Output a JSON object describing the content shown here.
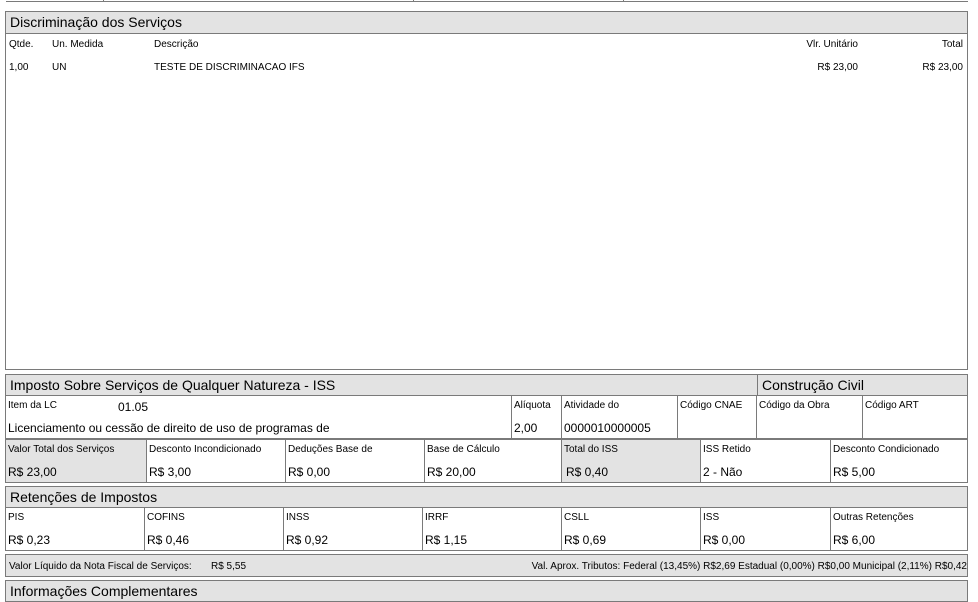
{
  "discriminacao": {
    "title": "Discriminação dos Serviços",
    "headers": {
      "qtde": "Qtde.",
      "un": "Un. Medida",
      "descricao": "Descrição",
      "vlr_unit": "Vlr. Unitário",
      "total": "Total"
    },
    "row": {
      "qtde": "1,00",
      "un": "UN",
      "descricao": "TESTE DE DISCRIMINACAO IFS",
      "vlr_unit": "R$ 23,00",
      "total": "R$ 23,00"
    }
  },
  "iss": {
    "title": "Imposto Sobre Serviços de Qualquer Natureza - ISS",
    "construcao_title": "Construção Civil",
    "item_lc_label": "Item da LC",
    "item_lc_value": "01.05",
    "item_desc": "Licenciamento ou cessão de direito de uso de programas de",
    "aliquota_label": "Alíquota",
    "aliquota_value": "2,00",
    "atividade_label": "Atividade do",
    "atividade_value": "0000010000005",
    "cnae_label": "Código CNAE",
    "obra_label": "Código da Obra",
    "art_label": "Código ART"
  },
  "valores": [
    {
      "label": "Valor Total dos Serviços",
      "value": "R$ 23,00"
    },
    {
      "label": "Desconto Incondicionado",
      "value": "R$ 3,00"
    },
    {
      "label": "Deduções Base de",
      "value": "R$ 0,00"
    },
    {
      "label": "Base de Cálculo",
      "value": "R$ 20,00"
    },
    {
      "label": "Total do ISS",
      "value": "R$ 0,40"
    },
    {
      "label": "ISS Retido",
      "value": "2 - Não"
    },
    {
      "label": "Desconto Condicionado",
      "value": "R$ 5,00"
    }
  ],
  "retencoes": {
    "title": "Retenções de Impostos",
    "items": [
      {
        "label": "PIS",
        "value": "R$ 0,23"
      },
      {
        "label": "COFINS",
        "value": "R$ 0,46"
      },
      {
        "label": "INSS",
        "value": "R$ 0,92"
      },
      {
        "label": "IRRF",
        "value": "R$ 1,15"
      },
      {
        "label": "CSLL",
        "value": "R$ 0,69"
      },
      {
        "label": "ISS",
        "value": "R$ 0,00"
      },
      {
        "label": "Outras Retenções",
        "value": "R$ 6,00"
      }
    ]
  },
  "liquido": {
    "label": "Valor Líquido da Nota Fiscal de Serviços:",
    "value": "R$ 5,55",
    "tributos": "Val. Aprox. Tributos: Federal (13,45%) R$2,69 Estadual (0,00%) R$0,00 Municipal (2,11%) R$0,42"
  },
  "complementares": {
    "title": "Informações Complementares"
  }
}
